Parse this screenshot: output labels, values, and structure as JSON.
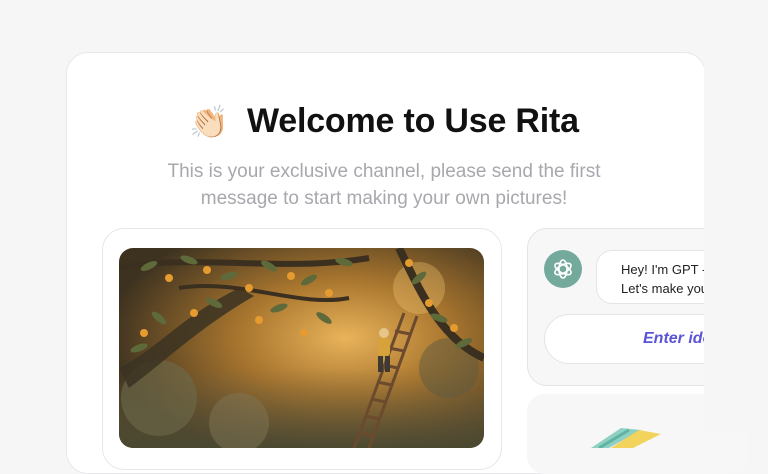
{
  "welcome": {
    "emoji": "👏🏻",
    "emoji_icon": "clapping-hands-icon",
    "title": "Welcome to Use Rita",
    "subtitle_line1": "This is your exclusive channel, please send the first",
    "subtitle_line2": "message to start making your own pictures!"
  },
  "chat": {
    "avatar_icon": "openai-logo-icon",
    "message_line1": "Hey! I'm GPT -",
    "message_line2": "Let's make you",
    "enter_label": "Enter ide"
  },
  "colors": {
    "accent": "#5b55d6",
    "avatar_bg": "#74aa9c",
    "title": "#111111",
    "subtitle": "#a7a7ad"
  }
}
